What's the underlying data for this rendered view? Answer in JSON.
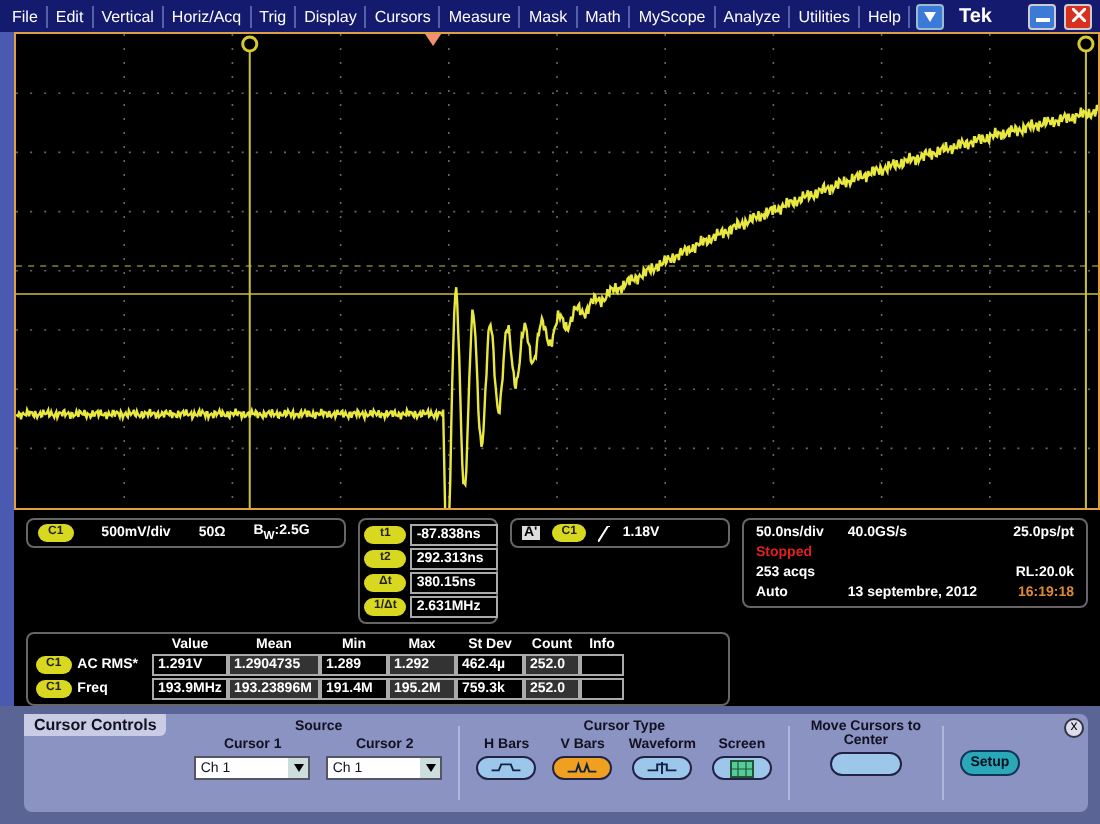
{
  "menu": {
    "items": [
      "File",
      "Edit",
      "Vertical",
      "Horiz/Acq",
      "Trig",
      "Display",
      "Cursors",
      "Measure",
      "Mask",
      "Math",
      "MyScope",
      "Analyze",
      "Utilities",
      "Help"
    ],
    "brand": "Tek"
  },
  "channel_readout": {
    "badge": "C1",
    "scale": "500mV/div",
    "impedance": "50Ω",
    "bandwidth": "B$_{W}$:2.5G"
  },
  "cursor_readouts": [
    {
      "badge": "t1",
      "value": "-87.838ns"
    },
    {
      "badge": "t2",
      "value": "292.313ns"
    },
    {
      "badge": "Δt",
      "value": "380.15ns"
    },
    {
      "badge": "1/Δt",
      "value": "2.631MHz"
    }
  ],
  "trigger": {
    "mode": "A'",
    "badge": "C1",
    "level": "1.18V"
  },
  "acquisition": {
    "timebase": "50.0ns/div",
    "sample_rate": "40.0GS/s",
    "resolution": "25.0ps/pt",
    "status": "Stopped",
    "acqs": "253 acqs",
    "record_length": "RL:20.0k",
    "trigger_mode": "Auto",
    "date": "13 septembre, 2012",
    "time": "16:19:18"
  },
  "measurements": {
    "columns": [
      "Value",
      "Mean",
      "Min",
      "Max",
      "St Dev",
      "Count",
      "Info"
    ],
    "rows": [
      {
        "badge": "C1",
        "name": "AC RMS*",
        "cells": [
          "1.291V",
          "1.2904735",
          "1.289",
          "1.292",
          "462.4µ",
          "252.0",
          ""
        ]
      },
      {
        "badge": "C1",
        "name": "Freq",
        "cells": [
          "193.9MHz",
          "193.23896M",
          "191.4M",
          "195.2M",
          "759.3k",
          "252.0",
          ""
        ]
      }
    ]
  },
  "cursor_controls": {
    "title": "Cursor Controls",
    "source_heading": "Source",
    "sources": [
      {
        "label": "Cursor 1",
        "value": "Ch 1"
      },
      {
        "label": "Cursor 2",
        "value": "Ch 1"
      }
    ],
    "type_heading": "Cursor Type",
    "types": [
      {
        "kind": "hbars",
        "label": "H Bars",
        "selected": false
      },
      {
        "kind": "vbars",
        "label": "V Bars",
        "selected": true
      },
      {
        "kind": "waveform",
        "label": "Waveform",
        "selected": false
      },
      {
        "kind": "screen",
        "label": "Screen",
        "selected": false
      }
    ],
    "center_label": "Move Cursors to Center",
    "setup": "Setup",
    "close": "x"
  }
}
